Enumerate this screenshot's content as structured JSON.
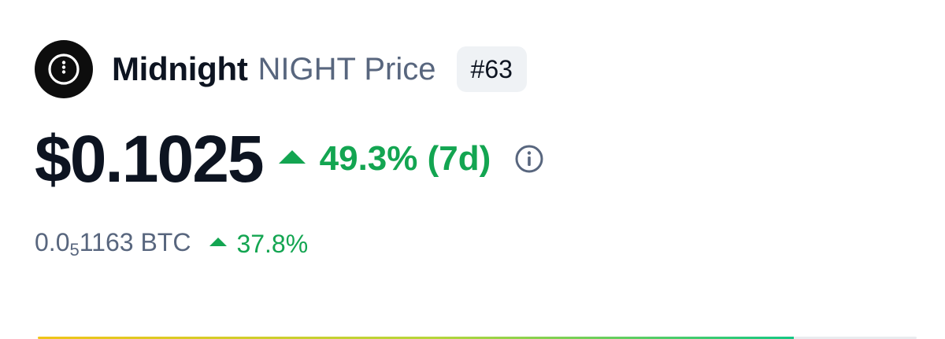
{
  "coin": {
    "name": "Midnight",
    "symbol_label": "NIGHT Price",
    "rank": "#63",
    "logo_icon": "midnight-logo-icon"
  },
  "price": {
    "usd": "$0.1025",
    "change_7d": "49.3% (7d)",
    "change_direction": "up",
    "info_icon": "info-icon"
  },
  "btc": {
    "prefix": "0.0",
    "zero_count": "5",
    "digits": "1163",
    "unit": " BTC",
    "change": "37.8%",
    "change_direction": "up"
  },
  "colors": {
    "text_primary": "#0d1421",
    "text_secondary": "#58667e",
    "positive": "#13a551",
    "badge_bg": "#eff2f5"
  }
}
